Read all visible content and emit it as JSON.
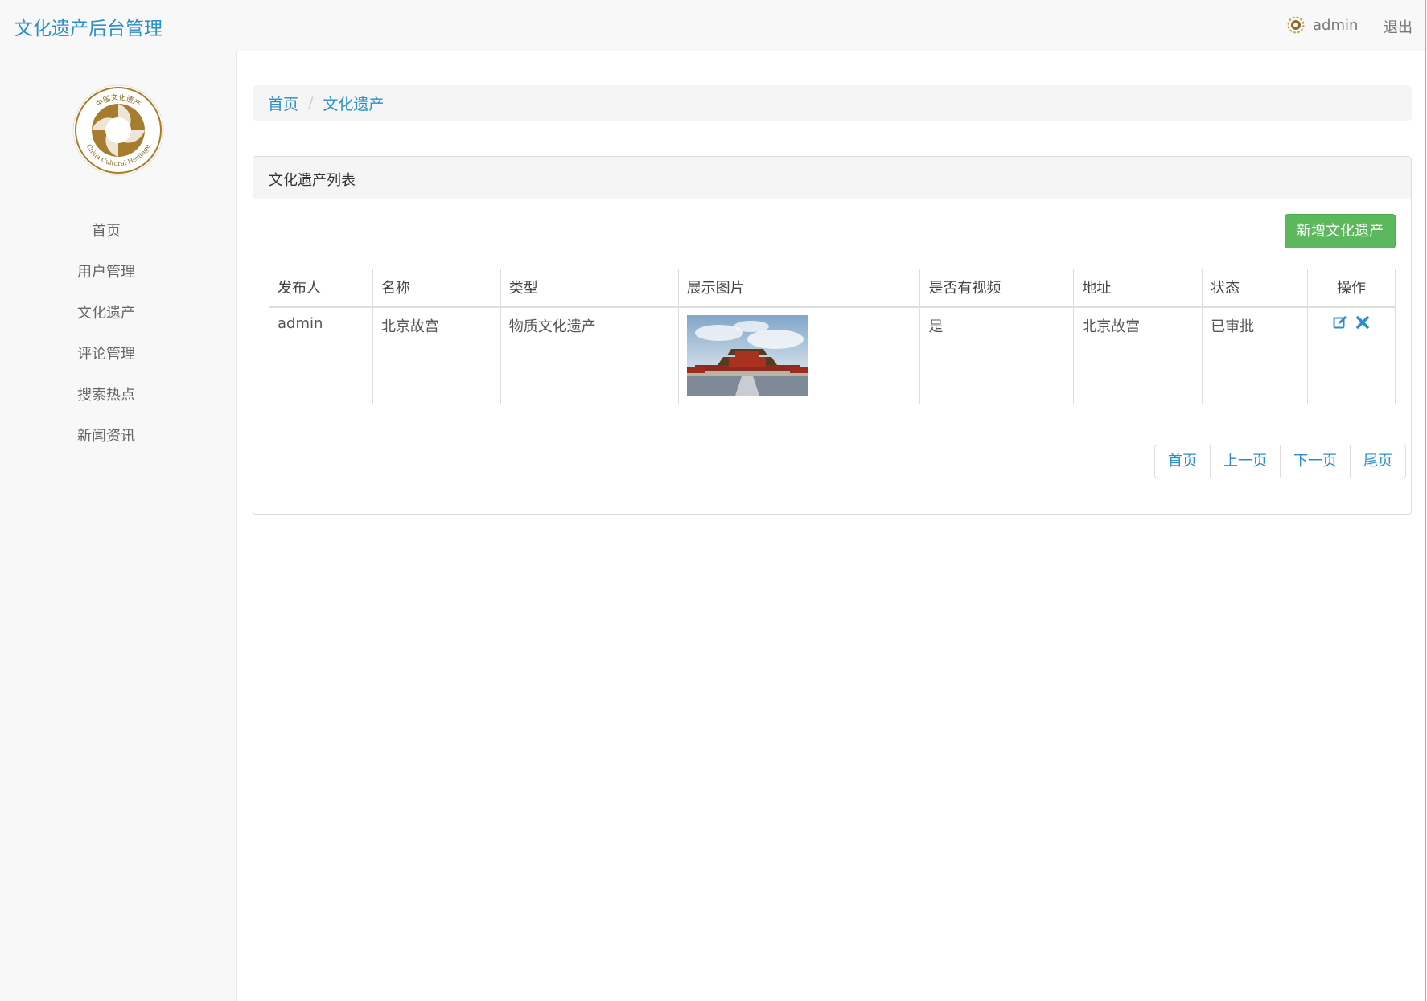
{
  "navbar": {
    "brand": "文化遗产后台管理",
    "username": "admin",
    "logout_label": "退出"
  },
  "sidebar": {
    "logo": {
      "top_text": "中国文化遗产",
      "bottom_text": "China Cultural Heritage"
    },
    "items": [
      {
        "label": "首页"
      },
      {
        "label": "用户管理"
      },
      {
        "label": "文化遗产"
      },
      {
        "label": "评论管理"
      },
      {
        "label": "搜索热点"
      },
      {
        "label": "新闻资讯"
      }
    ]
  },
  "breadcrumb": {
    "home": "首页",
    "current": "文化遗产"
  },
  "panel": {
    "title": "文化遗产列表",
    "add_button": "新增文化遗产"
  },
  "table": {
    "headers": [
      "发布人",
      "名称",
      "类型",
      "展示图片",
      "是否有视频",
      "地址",
      "状态",
      "操作"
    ],
    "rows": [
      {
        "publisher": "admin",
        "name": "北京故宫",
        "type": "物质文化遗产",
        "has_video": "是",
        "address": "北京故宫",
        "status": "已审批"
      }
    ]
  },
  "pagination": {
    "first": "首页",
    "prev": "上一页",
    "next": "下一页",
    "last": "尾页"
  },
  "colors": {
    "accent": "#2a8fc7",
    "success": "#5cb85c",
    "logo_gold": "#a67c2e"
  }
}
